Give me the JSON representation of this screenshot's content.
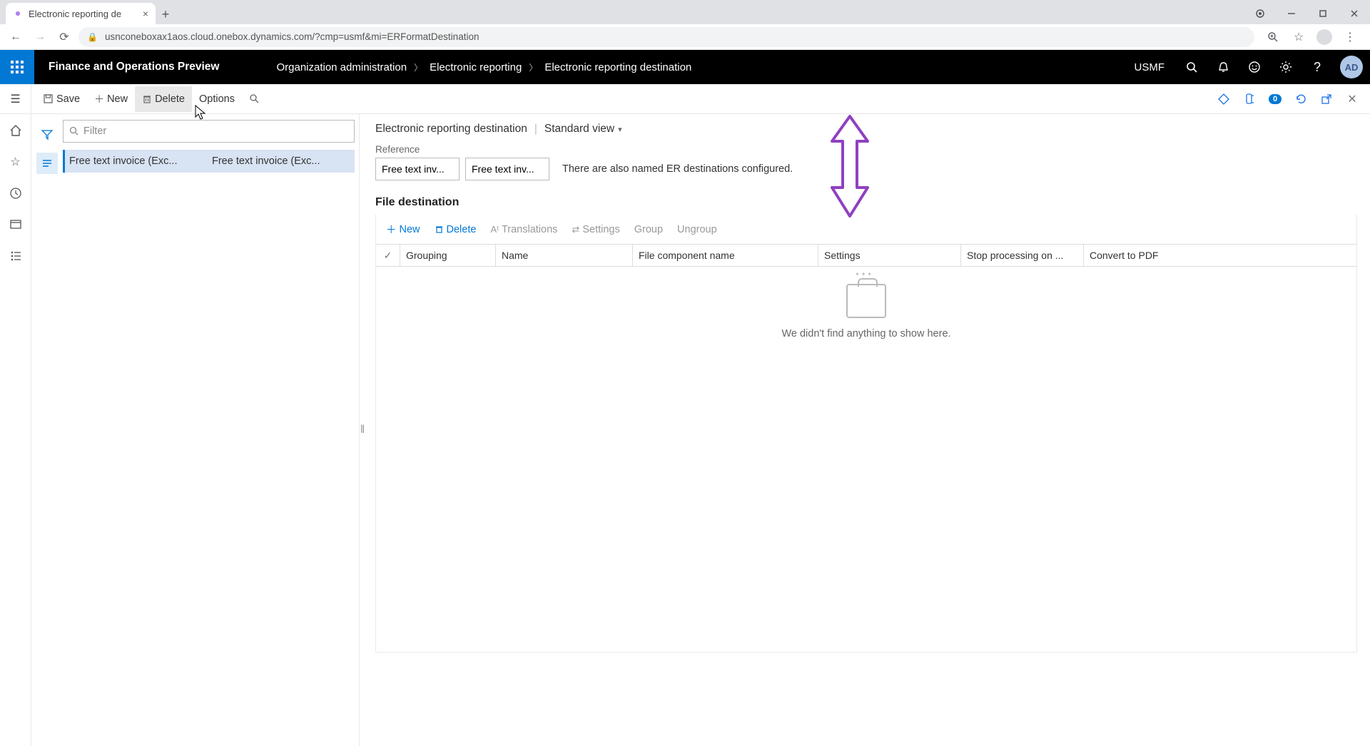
{
  "browser": {
    "tab_title": "Electronic reporting de",
    "url": "usnconeboxax1aos.cloud.onebox.dynamics.com/?cmp=usmf&mi=ERFormatDestination"
  },
  "topbar": {
    "app_title": "Finance and Operations Preview",
    "breadcrumbs": [
      "Organization administration",
      "Electronic reporting",
      "Electronic reporting destination"
    ],
    "company": "USMF",
    "user_initials": "AD"
  },
  "action_pane": {
    "save": "Save",
    "new": "New",
    "delete": "Delete",
    "options": "Options",
    "badge": "0"
  },
  "list": {
    "filter_placeholder": "Filter",
    "rows": [
      {
        "col1": "Free text invoice (Exc...",
        "col2": "Free text invoice (Exc..."
      }
    ]
  },
  "detail": {
    "page_title": "Electronic reporting destination",
    "view_name": "Standard view",
    "reference": {
      "label": "Reference",
      "box1": "Free text inv...",
      "box2": "Free text inv...",
      "message": "There are also named ER destinations configured."
    },
    "file_dest": {
      "title": "File destination",
      "toolbar": {
        "new": "New",
        "delete": "Delete",
        "translations": "Translations",
        "settings": "Settings",
        "group": "Group",
        "ungroup": "Ungroup"
      },
      "headers": {
        "grouping": "Grouping",
        "name": "Name",
        "file_component": "File component name",
        "settings": "Settings",
        "stop": "Stop processing on ...",
        "pdf": "Convert to PDF"
      },
      "empty_text": "We didn't find anything to show here."
    }
  }
}
